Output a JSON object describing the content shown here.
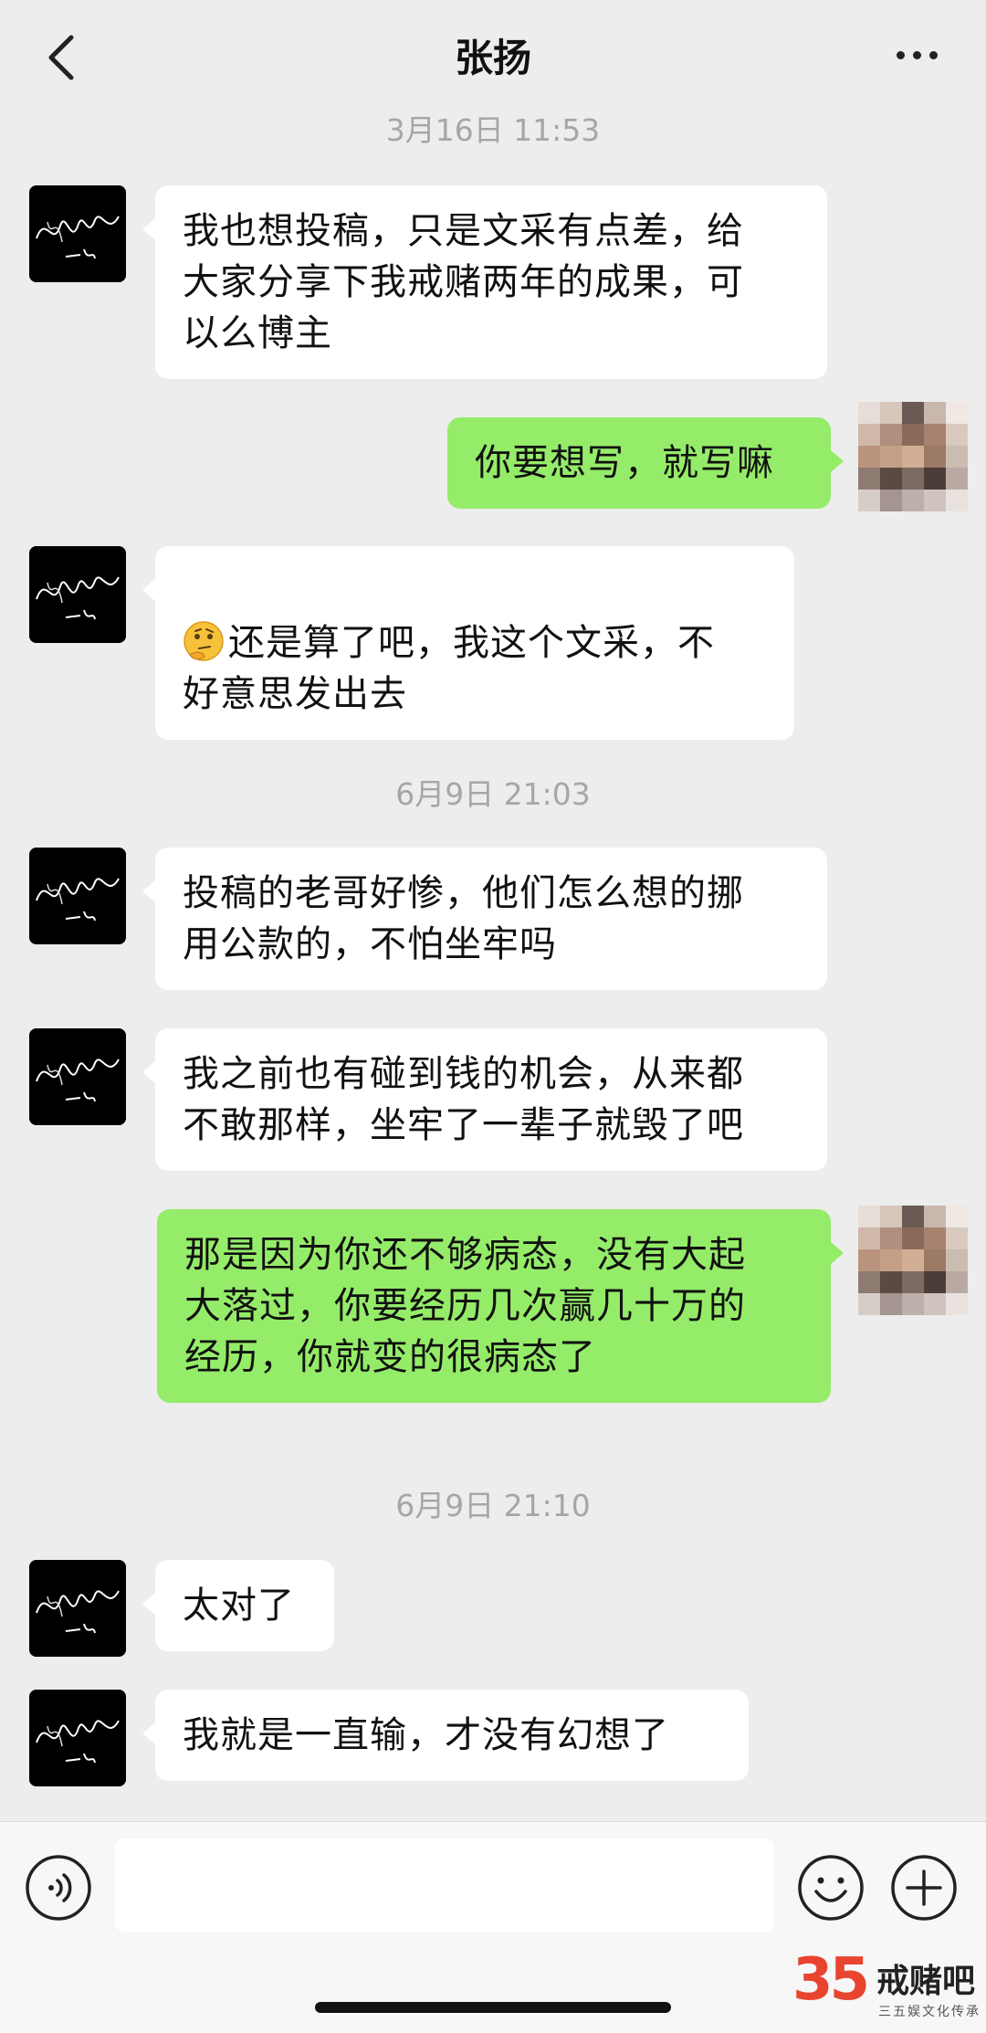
{
  "header": {
    "back_icon": "chevron-left-icon",
    "title": "张扬",
    "more_icon": "more-dots-icon"
  },
  "messages": [
    {
      "kind": "time",
      "text": "3月16日 11:53"
    },
    {
      "kind": "in",
      "text": "我也想投稿，只是文采有点差，给\n大家分享下我戒赌两年的成果，可\n以么博主"
    },
    {
      "kind": "out",
      "text": "你要想写，就写嘛"
    },
    {
      "kind": "in",
      "emoji": "thinking-face-icon",
      "text": "还是算了吧，我这个文采，不\n好意思发出去"
    },
    {
      "kind": "time",
      "text": "6月9日 21:03"
    },
    {
      "kind": "in",
      "text": "投稿的老哥好惨，他们怎么想的挪\n用公款的，不怕坐牢吗"
    },
    {
      "kind": "in",
      "text": "我之前也有碰到钱的机会，从来都\n不敢那样，坐牢了一辈子就毁了吧"
    },
    {
      "kind": "out",
      "text": "那是因为你还不够病态，没有大起\n大落过，你要经历几次赢几十万的\n经历，你就变的很病态了"
    },
    {
      "kind": "time",
      "text": "6月9日 21:10"
    },
    {
      "kind": "in",
      "text": "太对了"
    },
    {
      "kind": "in",
      "text": "我就是一直输，才没有幻想了"
    }
  ],
  "input_bar": {
    "voice_icon": "voice-icon",
    "text_value": "",
    "emoji_icon": "emoji-icon",
    "plus_icon": "plus-icon"
  },
  "watermark": {
    "logo_number": "35",
    "name": "戒赌吧",
    "subtitle": "三五娱文化传承"
  },
  "colors": {
    "background": "#ededed",
    "incoming_bubble": "#ffffff",
    "outgoing_bubble": "#95ec69",
    "timestamp": "#a6a6a6"
  }
}
